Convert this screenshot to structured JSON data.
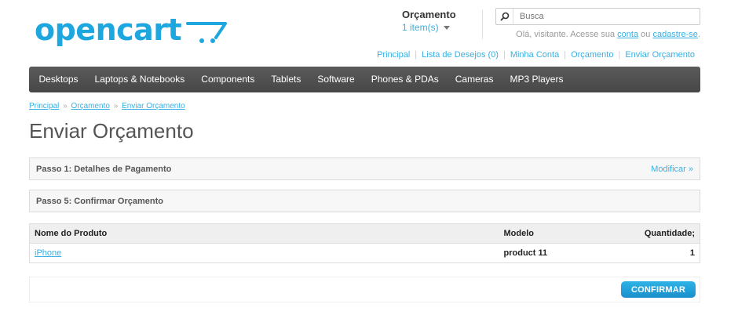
{
  "header": {
    "logo_text": "opencart",
    "cart": {
      "heading": "Orçamento",
      "total": "1 item(s)"
    },
    "search": {
      "placeholder": "Busca"
    },
    "welcome": {
      "prefix": "Olá, visitante. Acesse sua ",
      "login": "conta",
      "middle": " ou ",
      "register": "cadastre-se",
      "suffix": "."
    },
    "links": [
      "Principal",
      "Lista de Desejos (0)",
      "Minha Conta",
      "Orçamento",
      "Enviar Orçamento"
    ]
  },
  "menu": [
    "Desktops",
    "Laptops & Notebooks",
    "Components",
    "Tablets",
    "Software",
    "Phones & PDAs",
    "Cameras",
    "MP3 Players"
  ],
  "breadcrumb": [
    "Principal",
    "Orçamento",
    "Enviar Orçamento"
  ],
  "breadcrumb_separator": "»",
  "page_title": "Enviar Orçamento",
  "steps": {
    "step1": {
      "title": "Passo 1: Detalhes de Pagamento",
      "modify": "Modificar »"
    },
    "step5": {
      "title": "Passo 5: Confirmar Orçamento"
    }
  },
  "table": {
    "headers": {
      "name": "Nome do Produto",
      "model": "Modelo",
      "quantity": "Quantidade;"
    },
    "rows": [
      {
        "name": "iPhone",
        "model": "product 11",
        "quantity": "1"
      }
    ]
  },
  "confirm_button": "CONFIRMAR",
  "colors": {
    "accent": "#38b0e3",
    "logo": "#1ea6df",
    "menu_bg": "#4f4f4f"
  }
}
